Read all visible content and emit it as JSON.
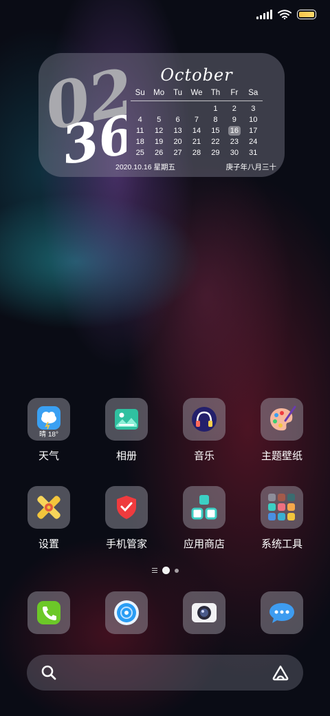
{
  "widget": {
    "clock_hour": "02",
    "clock_minute": "36",
    "month": "October",
    "weekdays": [
      "Su",
      "Mo",
      "Tu",
      "We",
      "Th",
      "Fr",
      "Sa"
    ],
    "weeks": [
      [
        "",
        "",
        "",
        "",
        "1",
        "2",
        "3"
      ],
      [
        "4",
        "5",
        "6",
        "7",
        "8",
        "9",
        "10"
      ],
      [
        "11",
        "12",
        "13",
        "14",
        "15",
        "16",
        "17"
      ],
      [
        "18",
        "19",
        "20",
        "21",
        "22",
        "23",
        "24"
      ],
      [
        "25",
        "26",
        "27",
        "28",
        "29",
        "30",
        "31"
      ]
    ],
    "today": "16",
    "date_text": "2020.10.16 星期五",
    "lunar_text": "庚子年八月三十"
  },
  "apps": [
    {
      "name": "weather",
      "label": "天气",
      "icon": "weather-icon",
      "sub": "晴 18°"
    },
    {
      "name": "gallery",
      "label": "相册",
      "icon": "gallery-icon"
    },
    {
      "name": "music",
      "label": "音乐",
      "icon": "music-icon"
    },
    {
      "name": "themes",
      "label": "主题壁纸",
      "icon": "palette-icon"
    },
    {
      "name": "settings",
      "label": "设置",
      "icon": "settings-icon"
    },
    {
      "name": "security",
      "label": "手机管家",
      "icon": "shield-icon"
    },
    {
      "name": "appstore",
      "label": "应用商店",
      "icon": "app-store-icon"
    },
    {
      "name": "tools",
      "label": "系统工具",
      "icon": "folder-icon"
    }
  ],
  "dock": [
    {
      "name": "phone",
      "icon": "phone-icon"
    },
    {
      "name": "browser",
      "icon": "browser-icon"
    },
    {
      "name": "camera",
      "icon": "camera-icon"
    },
    {
      "name": "messages",
      "icon": "messages-icon"
    }
  ],
  "colors": {
    "weather_blue": "#3aa0f2",
    "gallery_teal": "#2fc0a0",
    "music_navy": "#24206b",
    "palette_peach": "#f7b89d",
    "settings_yellow": "#f3c53c",
    "shield_red": "#ef3b3e",
    "store_teal": "#3ccfc4",
    "phone_green": "#6cc828",
    "browser_blue": "#2a9df4",
    "message_blue": "#3e9cf0",
    "battery_yellow": "#f6c44a"
  }
}
